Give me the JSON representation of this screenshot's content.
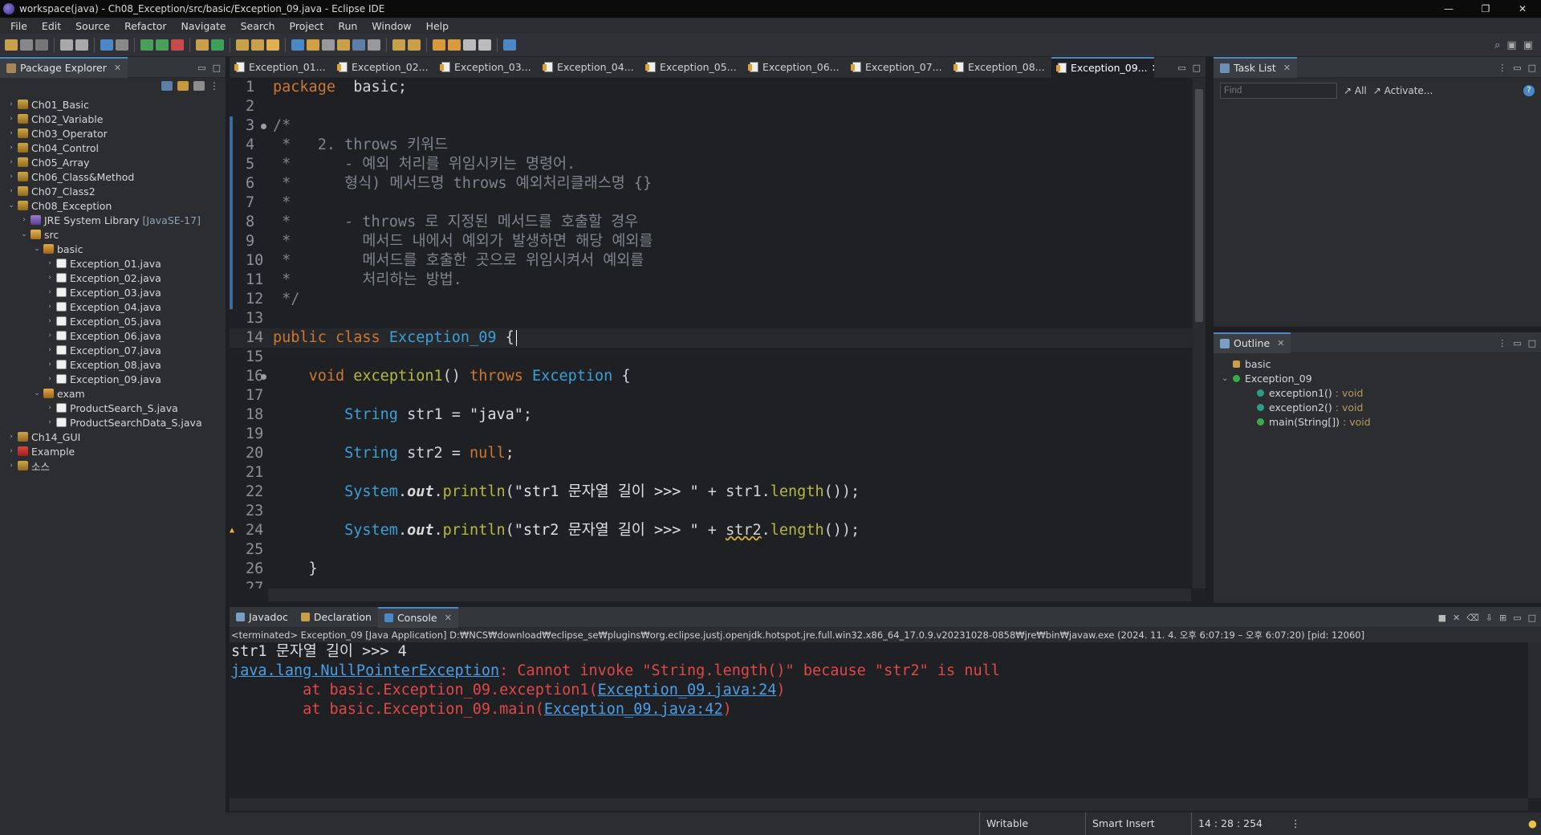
{
  "window": {
    "title": "workspace(java) - Ch08_Exception/src/basic/Exception_09.java - Eclipse IDE",
    "minimize": "—",
    "restore": "❐",
    "close": "✕"
  },
  "menu": [
    "File",
    "Edit",
    "Source",
    "Refactor",
    "Navigate",
    "Search",
    "Project",
    "Run",
    "Window",
    "Help"
  ],
  "package_explorer": {
    "title": "Package Explorer",
    "items": [
      {
        "label": "Ch01_Basic",
        "level": 0,
        "icon": "project-icon",
        "chev": "›"
      },
      {
        "label": "Ch02_Variable",
        "level": 0,
        "icon": "project-icon",
        "chev": "›"
      },
      {
        "label": "Ch03_Operator",
        "level": 0,
        "icon": "project-icon",
        "chev": "›"
      },
      {
        "label": "Ch04_Control",
        "level": 0,
        "icon": "project-icon",
        "chev": "›"
      },
      {
        "label": "Ch05_Array",
        "level": 0,
        "icon": "project-icon",
        "chev": "›"
      },
      {
        "label": "Ch06_Class&Method",
        "level": 0,
        "icon": "project-icon",
        "chev": "›"
      },
      {
        "label": "Ch07_Class2",
        "level": 0,
        "icon": "project-icon",
        "chev": "›"
      },
      {
        "label": "Ch08_Exception",
        "level": 0,
        "icon": "project-icon",
        "chev": "⌄"
      },
      {
        "label": "JRE System Library",
        "extra": "[JavaSE-17]",
        "level": 1,
        "icon": "library-icon",
        "chev": "›"
      },
      {
        "label": "src",
        "level": 1,
        "icon": "source-folder-icon",
        "chev": "⌄"
      },
      {
        "label": "basic",
        "level": 2,
        "icon": "package-icon",
        "chev": "⌄"
      },
      {
        "label": "Exception_01.java",
        "level": 3,
        "icon": "java-file-icon",
        "chev": "›"
      },
      {
        "label": "Exception_02.java",
        "level": 3,
        "icon": "java-file-icon",
        "chev": "›"
      },
      {
        "label": "Exception_03.java",
        "level": 3,
        "icon": "java-file-icon",
        "chev": "›"
      },
      {
        "label": "Exception_04.java",
        "level": 3,
        "icon": "java-file-icon",
        "chev": "›"
      },
      {
        "label": "Exception_05.java",
        "level": 3,
        "icon": "java-file-icon",
        "chev": "›"
      },
      {
        "label": "Exception_06.java",
        "level": 3,
        "icon": "java-file-icon",
        "chev": "›"
      },
      {
        "label": "Exception_07.java",
        "level": 3,
        "icon": "java-file-icon",
        "chev": "›"
      },
      {
        "label": "Exception_08.java",
        "level": 3,
        "icon": "java-file-icon",
        "chev": "›"
      },
      {
        "label": "Exception_09.java",
        "level": 3,
        "icon": "java-file-icon",
        "chev": "›"
      },
      {
        "label": "exam",
        "level": 2,
        "icon": "package-icon",
        "chev": "⌄"
      },
      {
        "label": "ProductSearch_S.java",
        "level": 3,
        "icon": "java-file-icon",
        "chev": "›"
      },
      {
        "label": "ProductSearchData_S.java",
        "level": 3,
        "icon": "java-file-icon",
        "chev": "›"
      },
      {
        "label": "Ch14_GUI",
        "level": 0,
        "icon": "project-icon",
        "chev": "›"
      },
      {
        "label": "Example",
        "level": 0,
        "icon": "error-project-icon",
        "chev": "›"
      },
      {
        "label": "소스",
        "level": 0,
        "icon": "project-icon",
        "chev": "›"
      }
    ]
  },
  "editor": {
    "tabs": [
      "Exception_01...",
      "Exception_02...",
      "Exception_03...",
      "Exception_04...",
      "Exception_05...",
      "Exception_06...",
      "Exception_07...",
      "Exception_08...",
      "Exception_09..."
    ],
    "active_tab": 8,
    "current_line": 14,
    "lines": [
      {
        "n": "1",
        "tokens": [
          [
            "kw",
            "package"
          ],
          [
            "",
            "  basic;"
          ]
        ]
      },
      {
        "n": "2",
        "tokens": []
      },
      {
        "n": "3",
        "fold": true,
        "tokens": [
          [
            "cm",
            "/*"
          ]
        ]
      },
      {
        "n": "4",
        "tokens": [
          [
            "cm",
            " *   2. throws 키워드"
          ]
        ]
      },
      {
        "n": "5",
        "tokens": [
          [
            "cm",
            " *      - 예외 처리를 위임시키는 명령어."
          ]
        ]
      },
      {
        "n": "6",
        "tokens": [
          [
            "cm",
            " *      형식) 메서드명 throws 예외처리클래스명 {}"
          ]
        ]
      },
      {
        "n": "7",
        "tokens": [
          [
            "cm",
            " *"
          ]
        ]
      },
      {
        "n": "8",
        "tokens": [
          [
            "cm",
            " *      - throws 로 지정된 메서드를 호출할 경우"
          ]
        ]
      },
      {
        "n": "9",
        "tokens": [
          [
            "cm",
            " *        메서드 내에서 예외가 발생하면 해당 예외를"
          ]
        ]
      },
      {
        "n": "10",
        "tokens": [
          [
            "cm",
            " *        메서드를 호출한 곳으로 위임시켜서 예외를"
          ]
        ]
      },
      {
        "n": "11",
        "tokens": [
          [
            "cm",
            " *        처리하는 방법."
          ]
        ]
      },
      {
        "n": "12",
        "tokens": [
          [
            "cm",
            " */"
          ]
        ]
      },
      {
        "n": "13",
        "tokens": []
      },
      {
        "n": "14",
        "tokens": [
          [
            "kw",
            "public"
          ],
          [
            "",
            " "
          ],
          [
            "kw",
            "class"
          ],
          [
            "",
            " "
          ],
          [
            "ty",
            "Exception_09"
          ],
          [
            "",
            " {"
          ]
        ]
      },
      {
        "n": "15",
        "tokens": []
      },
      {
        "n": "16",
        "fold": true,
        "tokens": [
          [
            "",
            "    "
          ],
          [
            "kw",
            "void"
          ],
          [
            "",
            " "
          ],
          [
            "mt",
            "exception1"
          ],
          [
            "",
            "() "
          ],
          [
            "kw",
            "throws"
          ],
          [
            "",
            " "
          ],
          [
            "ty",
            "Exception"
          ],
          [
            "",
            " {"
          ]
        ]
      },
      {
        "n": "17",
        "tokens": []
      },
      {
        "n": "18",
        "tokens": [
          [
            "",
            "        "
          ],
          [
            "ty",
            "String"
          ],
          [
            "",
            " str1 = "
          ],
          [
            "st",
            "\"java\""
          ],
          [
            "",
            ";"
          ]
        ]
      },
      {
        "n": "19",
        "tokens": []
      },
      {
        "n": "20",
        "tokens": [
          [
            "",
            "        "
          ],
          [
            "ty",
            "String"
          ],
          [
            "",
            " str2 = "
          ],
          [
            "kw",
            "null"
          ],
          [
            "",
            ";"
          ]
        ]
      },
      {
        "n": "21",
        "tokens": []
      },
      {
        "n": "22",
        "tokens": [
          [
            "",
            "        "
          ],
          [
            "ty",
            "System"
          ],
          [
            "",
            "."
          ],
          [
            "fd",
            "out"
          ],
          [
            "",
            "."
          ],
          [
            "mt",
            "println"
          ],
          [
            "",
            "("
          ],
          [
            "st",
            "\"str1 문자열 길이 >>> \""
          ],
          [
            "",
            " + str1."
          ],
          [
            "mt",
            "length"
          ],
          [
            "",
            "());"
          ]
        ]
      },
      {
        "n": "23",
        "tokens": []
      },
      {
        "n": "24",
        "tokens": [
          [
            "",
            "        "
          ],
          [
            "ty",
            "System"
          ],
          [
            "",
            "."
          ],
          [
            "fd",
            "out"
          ],
          [
            "",
            "."
          ],
          [
            "mt",
            "println"
          ],
          [
            "",
            "("
          ],
          [
            "st",
            "\"str2 문자열 길이 >>> \""
          ],
          [
            "",
            " + "
          ],
          [
            "warn",
            "str2"
          ],
          [
            "",
            "."
          ],
          [
            "mt",
            "length"
          ],
          [
            "",
            "());"
          ]
        ]
      },
      {
        "n": "25",
        "tokens": []
      },
      {
        "n": "26",
        "tokens": [
          [
            "",
            "    }"
          ]
        ]
      },
      {
        "n": "27",
        "tokens": []
      }
    ]
  },
  "task_list": {
    "title": "Task List",
    "find_placeholder": "Find",
    "all": "All",
    "activate": "Activate..."
  },
  "outline": {
    "title": "Outline",
    "items": [
      {
        "label": "basic",
        "ret": "",
        "level": 0,
        "icon": "package-icon"
      },
      {
        "label": "Exception_09",
        "ret": "",
        "level": 0,
        "icon": "class-icon"
      },
      {
        "label": "exception1()",
        "ret": ": void",
        "level": 1,
        "icon": "method-icon"
      },
      {
        "label": "exception2()",
        "ret": ": void",
        "level": 1,
        "icon": "method-icon"
      },
      {
        "label": "main(String[])",
        "ret": ": void",
        "level": 1,
        "icon": "static-method-icon"
      }
    ]
  },
  "console": {
    "tabs": [
      "Javadoc",
      "Declaration",
      "Console"
    ],
    "active_tab": 2,
    "header": "<terminated> Exception_09 [Java Application] D:₩NCS₩download₩eclipse_se₩plugins₩org.eclipse.justj.openjdk.hotspot.jre.full.win32.x86_64_17.0.9.v20231028-0858₩jre₩bin₩javaw.exe  (2024. 11. 4. 오후 6:07:19 – 오후 6:07:20) [pid: 12060]",
    "lines": [
      [
        [
          "out",
          "str1 문자열 길이 >>> 4"
        ]
      ],
      [
        [
          "link",
          "java.lang.NullPointerException"
        ],
        [
          "err",
          ": Cannot invoke \"String.length()\" because \"str2\" is null"
        ]
      ],
      [
        [
          "err",
          "        at basic.Exception_09.exception1("
        ],
        [
          "link",
          "Exception_09.java:24"
        ],
        [
          "err",
          ")"
        ]
      ],
      [
        [
          "err",
          "        at basic.Exception_09.main("
        ],
        [
          "link",
          "Exception_09.java:42"
        ],
        [
          "err",
          ")"
        ]
      ]
    ]
  },
  "status": {
    "writable": "Writable",
    "insert_mode": "Smart Insert",
    "position": "14 : 28 : 254"
  }
}
